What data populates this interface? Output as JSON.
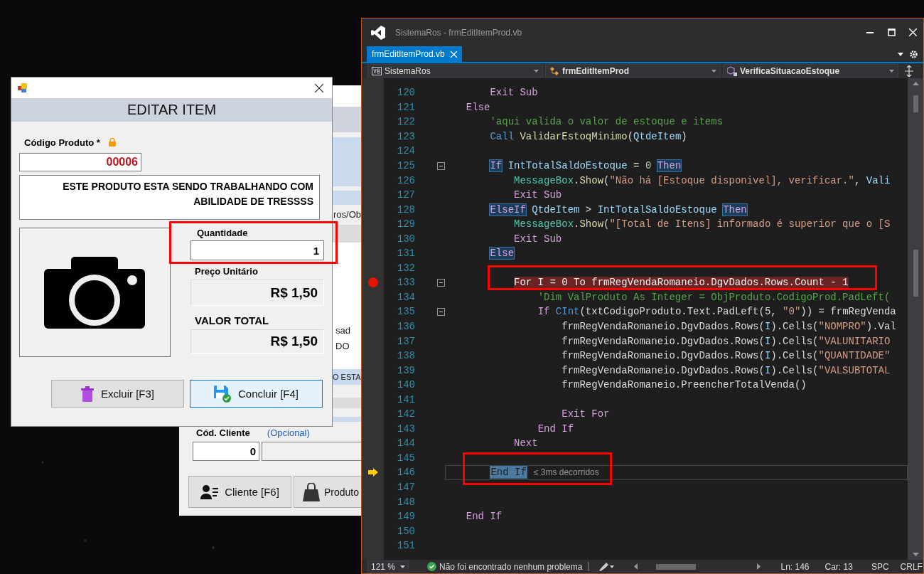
{
  "back_form": {
    "fragments": [
      "ros/Ob",
      "sad",
      "DO",
      "O ESTA"
    ],
    "client_label": "Cód. Cliente",
    "optional_note": "(Opcional)",
    "client_code": "0",
    "buttons": [
      {
        "label": "Cliente [F6]",
        "kind": "client"
      },
      {
        "label": "Produto",
        "kind": "bag"
      }
    ]
  },
  "edit_dialog": {
    "heading": "EDITAR ITEM",
    "product_code_label": "Código Produto *",
    "product_code": "00006",
    "description": "ESTE PRODUTO ESTA SENDO TRABALHANDO COM ABILIDADE DE TRESSSS",
    "quantity_label": "Quantidade",
    "quantity": "1",
    "unit_price_label": "Preço Unitário",
    "unit_price": "R$ 1,50",
    "total_label": "VALOR TOTAL",
    "total": "R$ 1,50",
    "buttons": [
      {
        "label": "Excluir [F3]",
        "kind": "delete",
        "selected": false
      },
      {
        "label": "Concluir [F4]",
        "kind": "save",
        "selected": true
      }
    ]
  },
  "ide": {
    "title": "SistemaRos - frmEditItemProd.vb",
    "tabs": [
      {
        "label": "frmEditItemProd.vb",
        "selected": true
      }
    ],
    "nav": [
      {
        "label": "SistemaRos",
        "kind": "project"
      },
      {
        "label": "frmEditItemProd",
        "kind": "class"
      },
      {
        "label": "VerificaSituacaoEstoque",
        "kind": "method"
      }
    ],
    "lines": [
      {
        "num": "120",
        "tokens": [
          {
            "text": "      Exit Sub",
            "kind": "keyword"
          }
        ],
        "breakpoint": false,
        "current": false,
        "fold": false
      },
      {
        "num": "121",
        "tokens": [
          {
            "text": "  Else",
            "kind": "keyword"
          }
        ],
        "breakpoint": false,
        "current": false,
        "fold": false
      },
      {
        "num": "122",
        "tokens": [
          {
            "text": "      'aqui valida o valor de estoque e items",
            "kind": "comment"
          }
        ],
        "breakpoint": false,
        "current": false,
        "fold": false
      },
      {
        "num": "123",
        "tokens": [
          {
            "text": "      Call ",
            "kind": "blue"
          },
          {
            "text": "ValidarEstoqMinimo",
            "kind": "method"
          },
          {
            "text": "(",
            "kind": "plain"
          },
          {
            "text": "QtdeItem",
            "kind": "ident"
          },
          {
            "text": ")",
            "kind": "plain"
          }
        ],
        "breakpoint": false,
        "current": false,
        "fold": false
      },
      {
        "num": "124",
        "breakpoint": false,
        "current": false,
        "fold": false
      },
      {
        "num": "125",
        "tokens": [
          {
            "text": "      If",
            "kind": "keyword_ref"
          },
          {
            "text": " IntTotalSaldoEstoque",
            "kind": "ident"
          },
          {
            "text": " = ",
            "kind": "plain"
          },
          {
            "text": "0 ",
            "kind": "number"
          },
          {
            "text": "Then",
            "kind": "keyword_ref"
          }
        ],
        "breakpoint": false,
        "current": false,
        "fold": true
      },
      {
        "num": "126",
        "tokens": [
          {
            "text": "          MessageBox",
            "kind": "type"
          },
          {
            "text": ".",
            "kind": "plain"
          },
          {
            "text": "Show",
            "kind": "method"
          },
          {
            "text": "(",
            "kind": "plain"
          },
          {
            "text": "\"Não há [Estoque disponivel], verificar.\"",
            "kind": "string"
          },
          {
            "text": ", ",
            "kind": "plain"
          },
          {
            "text": "Vali",
            "kind": "ident"
          }
        ],
        "breakpoint": false,
        "current": false,
        "fold": false
      },
      {
        "num": "127",
        "tokens": [
          {
            "text": "          Exit Sub",
            "kind": "keyword"
          }
        ],
        "breakpoint": false,
        "current": false,
        "fold": false
      },
      {
        "num": "128",
        "tokens": [
          {
            "text": "      ElseIf",
            "kind": "keyword_ref"
          },
          {
            "text": " QtdeItem",
            "kind": "ident"
          },
          {
            "text": " > ",
            "kind": "plain"
          },
          {
            "text": "IntTotalSaldoEstoque ",
            "kind": "ident"
          },
          {
            "text": "Then",
            "kind": "keyword_ref"
          }
        ],
        "breakpoint": false,
        "current": false,
        "fold": false
      },
      {
        "num": "129",
        "tokens": [
          {
            "text": "          MessageBox",
            "kind": "type"
          },
          {
            "text": ".",
            "kind": "plain"
          },
          {
            "text": "Show",
            "kind": "method"
          },
          {
            "text": "(",
            "kind": "plain"
          },
          {
            "text": "\"[Total de Itens] informado é superior que o [S",
            "kind": "string"
          }
        ],
        "breakpoint": false,
        "current": false,
        "fold": false
      },
      {
        "num": "130",
        "tokens": [
          {
            "text": "          Exit Sub",
            "kind": "keyword"
          }
        ],
        "breakpoint": false,
        "current": false,
        "fold": false
      },
      {
        "num": "131",
        "tokens": [
          {
            "text": "      Else",
            "kind": "keyword_ref"
          }
        ],
        "breakpoint": false,
        "current": false,
        "fold": false
      },
      {
        "num": "132",
        "breakpoint": false,
        "current": false,
        "fold": false
      },
      {
        "num": "133",
        "tokens": [
          {
            "text": "          For I = 0 To frmRegVendaRomaneio.DgvDados.Rows.Count - 1",
            "kind": "plain"
          }
        ],
        "breakpoint": true,
        "current": false,
        "fold": true
      },
      {
        "num": "134",
        "tokens": [
          {
            "text": "              'Dim ValProduto As Integer = ObjProduto.CodigoProd.PadLeft(",
            "kind": "comment"
          }
        ],
        "breakpoint": false,
        "current": false,
        "fold": false
      },
      {
        "num": "135",
        "tokens": [
          {
            "text": "              If ",
            "kind": "keyword"
          },
          {
            "text": "CInt",
            "kind": "blue"
          },
          {
            "text": "(txtCodigoProduto.Text.PadLeft(5, ",
            "kind": "plain"
          },
          {
            "text": "\"0\"",
            "kind": "string"
          },
          {
            "text": ")) = frmRegVenda",
            "kind": "plain"
          }
        ],
        "breakpoint": false,
        "current": false,
        "fold": true
      },
      {
        "num": "136",
        "tokens": [
          {
            "text": "                  frmRegVendaRomaneio.DgvDados.Rows(",
            "kind": "plain"
          },
          {
            "text": "I",
            "kind": "ident"
          },
          {
            "text": ").Cells(",
            "kind": "plain"
          },
          {
            "text": "\"NOMPRO\"",
            "kind": "string"
          },
          {
            "text": ").Val",
            "kind": "plain"
          }
        ],
        "breakpoint": false,
        "current": false,
        "fold": false
      },
      {
        "num": "137",
        "tokens": [
          {
            "text": "                  frmRegVendaRomaneio.DgvDados.Rows(",
            "kind": "plain"
          },
          {
            "text": "I",
            "kind": "ident"
          },
          {
            "text": ").Cells(",
            "kind": "plain"
          },
          {
            "text": "\"VALUNITARIO",
            "kind": "string"
          }
        ],
        "breakpoint": false,
        "current": false,
        "fold": false
      },
      {
        "num": "138",
        "tokens": [
          {
            "text": "                  frmRegVendaRomaneio.DgvDados.Rows(",
            "kind": "plain"
          },
          {
            "text": "I",
            "kind": "ident"
          },
          {
            "text": ").Cells(",
            "kind": "plain"
          },
          {
            "text": "\"QUANTIDADE\"",
            "kind": "string"
          }
        ],
        "breakpoint": false,
        "current": false,
        "fold": false
      },
      {
        "num": "139",
        "tokens": [
          {
            "text": "                  frmRegVendaRomaneio.DgvDados.Rows(",
            "kind": "plain"
          },
          {
            "text": "I",
            "kind": "ident"
          },
          {
            "text": ").Cells(",
            "kind": "plain"
          },
          {
            "text": "\"VALSUBTOTAL",
            "kind": "string"
          }
        ],
        "breakpoint": false,
        "current": false,
        "fold": false
      },
      {
        "num": "140",
        "tokens": [
          {
            "text": "                  frmRegVendaRomaneio.PreencherTotalVenda()",
            "kind": "plain"
          }
        ],
        "breakpoint": false,
        "current": false,
        "fold": false
      },
      {
        "num": "141",
        "breakpoint": false,
        "current": false,
        "fold": false
      },
      {
        "num": "142",
        "tokens": [
          {
            "text": "                  Exit For",
            "kind": "keyword"
          }
        ],
        "breakpoint": false,
        "current": false,
        "fold": false
      },
      {
        "num": "143",
        "tokens": [
          {
            "text": "              End If",
            "kind": "keyword"
          }
        ],
        "breakpoint": false,
        "current": false,
        "fold": false
      },
      {
        "num": "144",
        "tokens": [
          {
            "text": "          Next",
            "kind": "keyword"
          }
        ],
        "breakpoint": false,
        "current": false,
        "fold": false
      },
      {
        "num": "145",
        "breakpoint": false,
        "current": false,
        "fold": false
      },
      {
        "num": "146",
        "tokens": [
          {
            "text": "      End If",
            "kind": "keyword_ref"
          }
        ],
        "hint": "≤ 3ms decorridos",
        "breakpoint": false,
        "current": true,
        "fold": false
      },
      {
        "num": "147",
        "breakpoint": false,
        "current": false,
        "fold": false
      },
      {
        "num": "148",
        "breakpoint": false,
        "current": false,
        "fold": false
      },
      {
        "num": "149",
        "tokens": [
          {
            "text": "  End If",
            "kind": "keyword"
          }
        ],
        "breakpoint": false,
        "current": false,
        "fold": false
      },
      {
        "num": "150",
        "breakpoint": false,
        "current": false,
        "fold": false
      },
      {
        "num": "151",
        "breakpoint": false,
        "current": false,
        "fold": false
      }
    ],
    "status": {
      "zoom": "121 %",
      "message": "Não foi encontrado nenhum problema",
      "line": "Ln: 146",
      "column": "Car: 13",
      "indent": "SPC",
      "line_ending": "CRLF"
    }
  }
}
